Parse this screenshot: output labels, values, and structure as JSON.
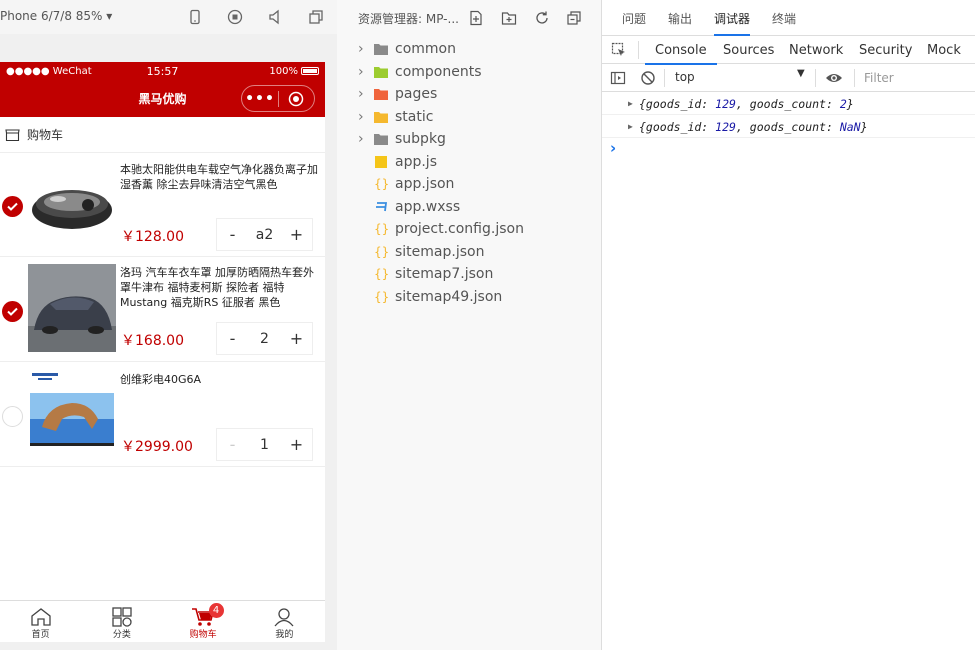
{
  "simulator": {
    "device_label": "Phone 6/7/8 85% ▾",
    "status_carrier": "●●●●● WeChat",
    "status_time": "15:57",
    "status_battery": "100%",
    "nav_title": "黑马优购",
    "nav_more": "•••"
  },
  "cart": {
    "header_label": "购物车",
    "items": [
      {
        "name": "本驰太阳能供电车载空气净化器负离子加湿香薰 除尘去异味清洁空气黑色",
        "price": "￥128.00",
        "qty": "a2",
        "checked": true,
        "minus": "-",
        "plus": "+"
      },
      {
        "name": "洛玛 汽车车衣车罩 加厚防晒隔热车套外罩牛津布 福特麦柯斯 探险者 福特Mustang 福克斯RS 征服者 黑色",
        "price": "￥168.00",
        "qty": "2",
        "checked": true,
        "minus": "-",
        "plus": "+"
      },
      {
        "name": "创维彩电40G6A",
        "price": "￥2999.00",
        "qty": "1",
        "checked": false,
        "minus": "-",
        "plus": "+"
      }
    ]
  },
  "tabbar": {
    "items": [
      {
        "label": "首页",
        "icon": "home-icon"
      },
      {
        "label": "分类",
        "icon": "category-icon"
      },
      {
        "label": "购物车",
        "icon": "cart-icon",
        "badge": "4",
        "active": true
      },
      {
        "label": "我的",
        "icon": "user-icon"
      }
    ]
  },
  "explorer": {
    "title": "资源管理器: MP-...",
    "entries": [
      {
        "label": "common",
        "type": "folder",
        "color": "#8a8a8a"
      },
      {
        "label": "components",
        "type": "folder",
        "color": "#9ccc2f"
      },
      {
        "label": "pages",
        "type": "folder",
        "color": "#f0643c"
      },
      {
        "label": "static",
        "type": "folder",
        "color": "#f5b82e"
      },
      {
        "label": "subpkg",
        "type": "folder",
        "color": "#8a8a8a"
      },
      {
        "label": "app.js",
        "type": "js",
        "color": "#f5c518"
      },
      {
        "label": "app.json",
        "type": "json",
        "color": "#f5b82e"
      },
      {
        "label": "app.wxss",
        "type": "css",
        "color": "#3b8ee0"
      },
      {
        "label": "project.config.json",
        "type": "json",
        "color": "#f5b82e"
      },
      {
        "label": "sitemap.json",
        "type": "json",
        "color": "#f5b82e"
      },
      {
        "label": "sitemap7.json",
        "type": "json",
        "color": "#f5b82e"
      },
      {
        "label": "sitemap49.json",
        "type": "json",
        "color": "#f5b82e"
      }
    ]
  },
  "devtools": {
    "top_tabs": [
      "问题",
      "输出",
      "调试器",
      "终端"
    ],
    "panel_tabs": [
      "Console",
      "Sources",
      "Network",
      "Security",
      "Mock"
    ],
    "context": "top",
    "filter_placeholder": "Filter",
    "logs": [
      {
        "prefix": "{goods_id: ",
        "id": "129",
        "mid": ", goods_count: ",
        "count": "2",
        "suffix": "}"
      },
      {
        "prefix": "{goods_id: ",
        "id": "129",
        "mid": ", goods_count: ",
        "count": "NaN",
        "suffix": "}"
      }
    ],
    "prompt": "›"
  },
  "colors": {
    "accent": "#c00000",
    "link": "#1a73e8"
  }
}
